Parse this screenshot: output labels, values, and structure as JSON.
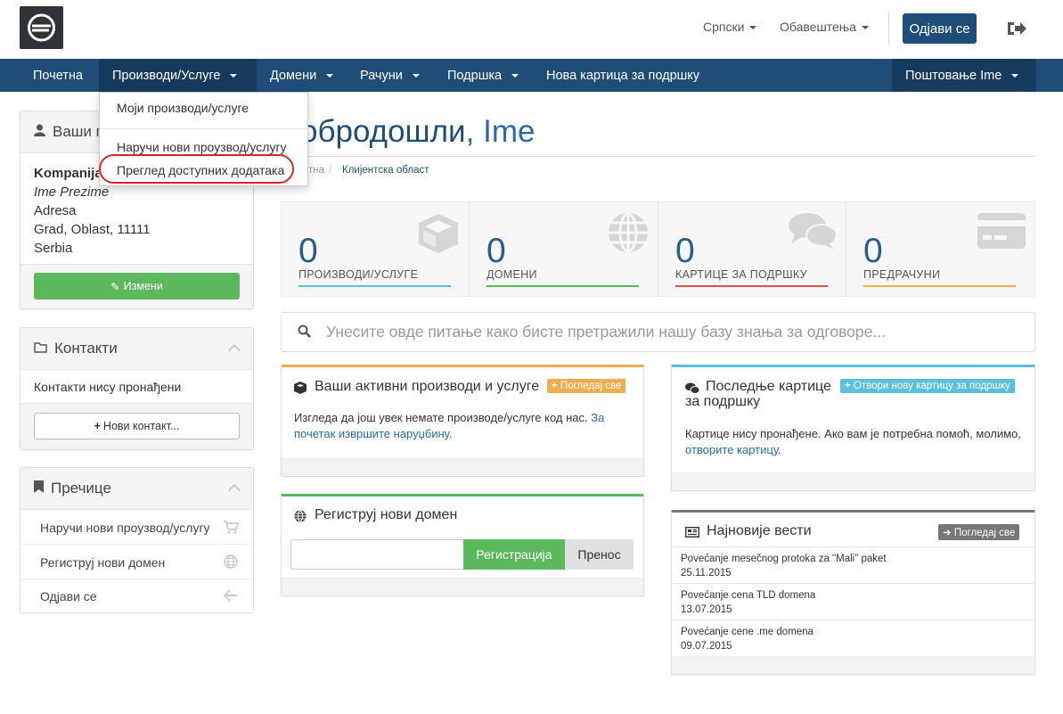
{
  "header": {
    "language": "Српски",
    "notifications": "Обавештења",
    "logout_button": "Одјави се"
  },
  "nav": {
    "home": "Почетна",
    "services": "Производи/Услуге",
    "domains": "Домени",
    "billing": "Рачуни",
    "support": "Подршка",
    "open_ticket": "Нова картица за подршку",
    "account": "Поштовање Ime"
  },
  "dropdown": {
    "items": [
      "Моји производи/услуге",
      "Наручи нови проузвод/услугу",
      "Преглед доступних додатака"
    ]
  },
  "sidebar": {
    "info": {
      "title": "Ваши п",
      "company": "Kompanija",
      "name": "Ime Prezime",
      "address": "Adresa",
      "city": "Grad, Oblast, 11111",
      "country": "Serbia",
      "edit_button": "Измени"
    },
    "contacts": {
      "title": "Контакти",
      "empty": "Контакти нису пронађени",
      "new_button": "Нови контакт..."
    },
    "shortcuts": {
      "title": "Пречице",
      "items": [
        "Наручи нови проузвод/услугу",
        "Региструј нови домен",
        "Одјави се"
      ]
    }
  },
  "main": {
    "welcome_prefix": "обродошли",
    "welcome_sep": ",",
    "welcome_name": "Ime",
    "breadcrumb": {
      "home_partial": "тна",
      "sep": "/",
      "current": "Клијентска област"
    },
    "tiles": [
      {
        "value": "0",
        "label": "ПРОИЗВОДИ/УСЛУГЕ",
        "color": "#5bc0de"
      },
      {
        "value": "0",
        "label": "ДОМЕНИ",
        "color": "#5cb85c"
      },
      {
        "value": "0",
        "label": "КАРТИЦЕ ЗА ПОДРШКУ",
        "color": "#d9534f"
      },
      {
        "value": "0",
        "label": "ПРЕДРАЧУНИ",
        "color": "#f0ad4e"
      }
    ],
    "search_placeholder": "Унесите овде питање како бисте претражили нашу базу знања за одговоре...",
    "services_card": {
      "title": "Ваши активни производи и услуге",
      "badge": "Погледај све",
      "text": "Изгледа да још увек немате производе/услуге код нас.",
      "link": "За почетак извршите наруџбину."
    },
    "tickets_card": {
      "title_line1": "Последње картице",
      "title_line2": "за подршку",
      "badge": "Отвори нову картицу за подршку",
      "text": "Картице нису пронађене. Ако вам је потребна помоћ, молимо,",
      "link": "отворите картицу",
      "text_end": "."
    },
    "domain_card": {
      "title": "Региструј нови домен",
      "register_button": "Регистрација",
      "transfer_button": "Пренос"
    },
    "news_card": {
      "title": "Најновије вести",
      "badge": "Погледај све",
      "items": [
        {
          "title": "Povećanje mesečnog protoka za \"Mali\" paket",
          "date": "25.11.2015"
        },
        {
          "title": "Povećanje cena TLD domena",
          "date": "13.07.2015"
        },
        {
          "title": "Povećanje cene .me domena",
          "date": "09.07.2015"
        }
      ]
    }
  },
  "colors": {
    "brand": "#1f4d78",
    "green": "#5cb85c",
    "orange": "#f0ad4e",
    "info": "#5bc0de",
    "highlight": "#d9252a"
  }
}
